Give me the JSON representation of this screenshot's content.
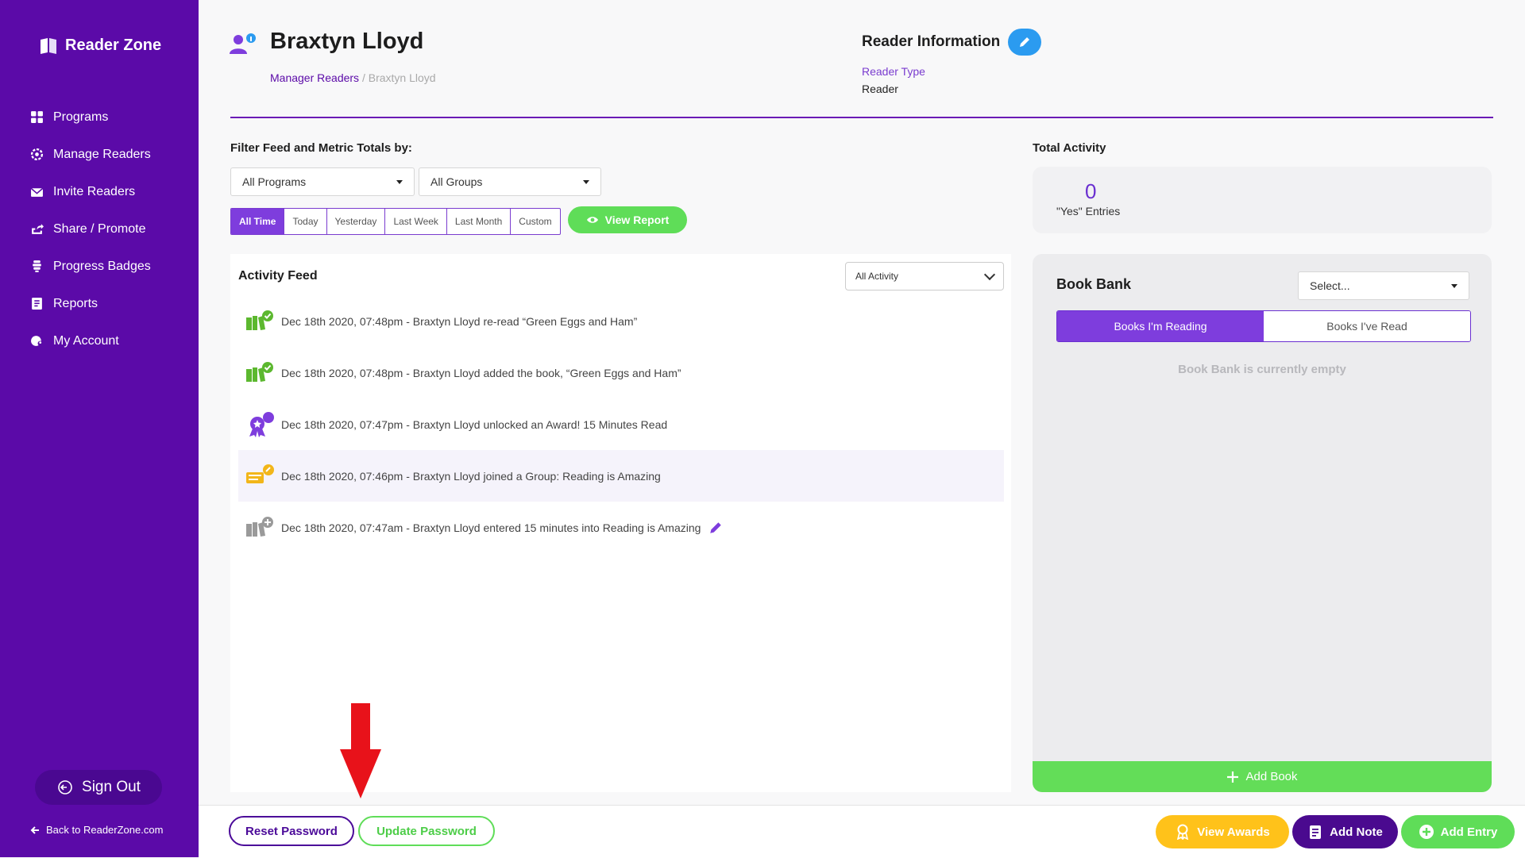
{
  "sidebar": {
    "brand": "Reader Zone",
    "items": [
      {
        "label": "Programs",
        "icon": "grid-icon"
      },
      {
        "label": "Manage Readers",
        "icon": "gear-icon"
      },
      {
        "label": "Invite Readers",
        "icon": "envelope-icon"
      },
      {
        "label": "Share / Promote",
        "icon": "share-icon"
      },
      {
        "label": "Progress Badges",
        "icon": "badges-icon"
      },
      {
        "label": "Reports",
        "icon": "report-icon"
      },
      {
        "label": "My Account",
        "icon": "globe-user-icon"
      }
    ],
    "sign_out": "Sign Out",
    "back_link": "Back to ReaderZone.com"
  },
  "header": {
    "title": "Braxtyn Lloyd",
    "breadcrumb": {
      "parent": "Manager Readers",
      "separator": "/",
      "current": "Braxtyn Lloyd"
    },
    "reader_info": {
      "title": "Reader Information",
      "type_label": "Reader Type",
      "type_value": "Reader"
    }
  },
  "filters": {
    "label": "Filter Feed and Metric Totals by:",
    "programs": "All Programs",
    "groups": "All Groups",
    "ranges": [
      "All Time",
      "Today",
      "Yesterday",
      "Last Week",
      "Last Month",
      "Custom"
    ],
    "selected_range": "All Time",
    "view_report": "View Report"
  },
  "activity": {
    "title": "Activity Feed",
    "filter": "All Activity",
    "items": [
      {
        "text": "Dec 18th 2020, 07:48pm - Braxtyn Lloyd re-read “Green Eggs and Ham”",
        "icon": "book-check-icon"
      },
      {
        "text": "Dec 18th 2020, 07:48pm - Braxtyn Lloyd added the book, “Green Eggs and Ham”",
        "icon": "book-check-icon"
      },
      {
        "text": "Dec 18th 2020, 07:47pm - Braxtyn Lloyd unlocked an Award! 15 Minutes Read",
        "icon": "award-icon"
      },
      {
        "text": "Dec 18th 2020, 07:46pm - Braxtyn Lloyd joined a Group: Reading is Amazing",
        "icon": "group-icon"
      },
      {
        "text": "Dec 18th 2020, 07:47am - Braxtyn Lloyd entered 15 minutes into Reading is Amazing",
        "icon": "book-plus-icon"
      }
    ]
  },
  "total_activity": {
    "title": "Total Activity",
    "value": "0",
    "caption": "\"Yes\" Entries"
  },
  "book_bank": {
    "title": "Book Bank",
    "select_placeholder": "Select...",
    "tabs": [
      "Books I'm Reading",
      "Books I've Read"
    ],
    "active_tab": "Books I'm Reading",
    "empty": "Book Bank is currently empty",
    "add_book": "Add Book"
  },
  "footer": {
    "reset_password": "Reset Password",
    "update_password": "Update Password",
    "view_awards": "View Awards",
    "add_note": "Add Note",
    "add_entry": "Add Entry"
  },
  "colors": {
    "sidebar": "#5b0aa8",
    "accent_purple": "#7e3ddd",
    "green": "#5fdd58",
    "yellow": "#ffc21a",
    "blue": "#2b9bf0",
    "arrow": "#e8121a"
  }
}
